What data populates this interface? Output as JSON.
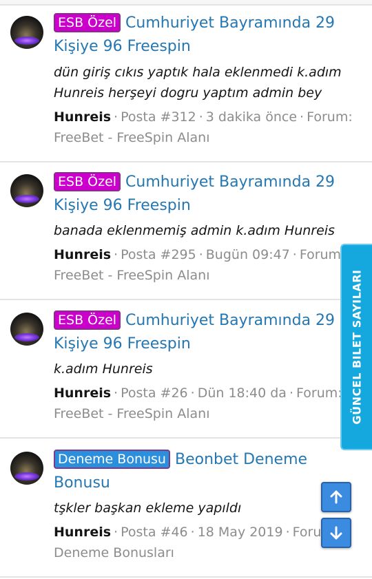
{
  "side_tab": {
    "label": "GÜNCEL BILET SAYILARI"
  },
  "results": [
    {
      "badge": "ESB Özel",
      "badge_style": "esb",
      "title_line1": "Cumhuriyet Bayramında 29",
      "title_line2": "Kişiye 96 Freespin",
      "snippet": [
        "dün giriş cıkıs yaptık hala eklenmedi k.adım",
        "Hunreis herşeyi dogru yaptım admin bey"
      ],
      "author": "Hunreis",
      "post": "Posta #312",
      "time": "3 dakika önce",
      "forum_label": "Forum:",
      "forum": "FreeBet - FreeSpin Alanı"
    },
    {
      "badge": "ESB Özel",
      "badge_style": "esb",
      "title_line1": "Cumhuriyet Bayramında 29",
      "title_line2": "Kişiye 96 Freespin",
      "snippet": [
        "banada eklenmemiş admin k.adım Hunreis"
      ],
      "author": "Hunreis",
      "post": "Posta #295",
      "time": "Bugün 09:47",
      "forum_label": "Forum:",
      "forum": "FreeBet - FreeSpin Alanı"
    },
    {
      "badge": "ESB Özel",
      "badge_style": "esb",
      "title_line1": "Cumhuriyet Bayramında 29",
      "title_line2": "Kişiye 96 Freespin",
      "snippet": [
        "k.adım Hunreis"
      ],
      "author": "Hunreis",
      "post": "Posta #26",
      "time": "Dün 18:40 da",
      "forum_label": "Forum:",
      "forum": "FreeBet - FreeSpin Alanı"
    },
    {
      "badge": "Deneme Bonusu",
      "badge_style": "deneme",
      "title_line1": "Beonbet Deneme",
      "title_line2": "Bonusu",
      "snippet": [
        "tşkler başkan ekleme yapıldı"
      ],
      "author": "Hunreis",
      "post": "Posta #46",
      "time": "18 May 2019",
      "forum_label": "Forum:",
      "forum": "Deneme Bonusları"
    }
  ],
  "icons": {
    "scroll_up": "arrow-up-icon",
    "scroll_down": "arrow-down-icon"
  }
}
